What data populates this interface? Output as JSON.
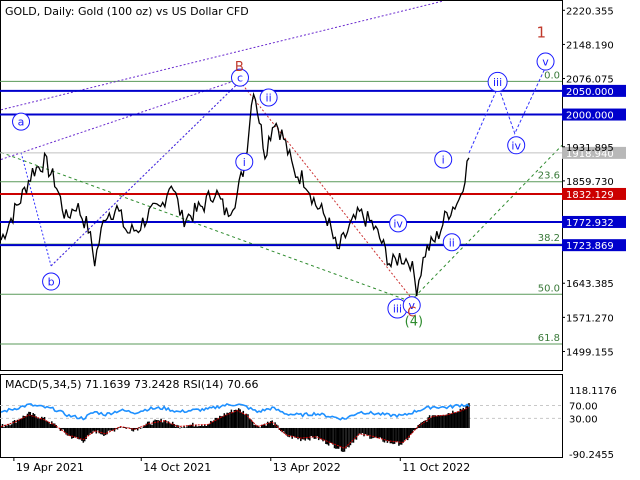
{
  "chart_data": {
    "type": "line",
    "title": "GOLD, Daily:  Gold (100 oz) vs US Dollar CFD",
    "x_ticks": [
      "19 Apr 2021",
      "14 Oct 2021",
      "13 Apr 2022",
      "11 Oct 2022"
    ],
    "x_range": [
      "2021-04-01",
      "2023-05-25"
    ],
    "price_axis": {
      "tick_labels": [
        "2220.355",
        "2148.190",
        "2076.075",
        "1931.895",
        "1859.730",
        "1643.385",
        "1571.270",
        "1499.155"
      ],
      "ylim": [
        1460,
        2240
      ]
    },
    "levels": [
      {
        "label": "2050.000",
        "value": 2050.0,
        "color": "#0000cc"
      },
      {
        "label": "2000.000",
        "value": 2000.0,
        "color": "#0000cc"
      },
      {
        "label": "1832.129",
        "value": 1832.129,
        "color": "#cc0000"
      },
      {
        "label": "1772.932",
        "value": 1772.932,
        "color": "#0000cc"
      },
      {
        "label": "1723.869",
        "value": 1723.869,
        "color": "#0000cc"
      }
    ],
    "current_price": {
      "label": "1918.940",
      "value": 1918.94
    },
    "fibonacci": [
      {
        "label": "0.0",
        "value": 2070
      },
      {
        "label": "23.6",
        "value": 1858
      },
      {
        "label": "38.2",
        "value": 1726
      },
      {
        "label": "50.0",
        "value": 1620
      },
      {
        "label": "61.8",
        "value": 1515
      }
    ],
    "price_series": {
      "x": [
        "2021-04-01",
        "2021-04-15",
        "2021-05-01",
        "2021-05-15",
        "2021-06-01",
        "2021-06-15",
        "2021-07-01",
        "2021-07-15",
        "2021-08-01",
        "2021-08-10",
        "2021-08-25",
        "2021-09-10",
        "2021-09-25",
        "2021-10-10",
        "2021-10-25",
        "2021-11-10",
        "2021-11-25",
        "2021-12-10",
        "2021-12-25",
        "2022-01-10",
        "2022-01-25",
        "2022-02-10",
        "2022-02-25",
        "2022-03-08",
        "2022-03-20",
        "2022-04-05",
        "2022-04-18",
        "2022-05-01",
        "2022-05-15",
        "2022-06-01",
        "2022-06-15",
        "2022-07-01",
        "2022-07-15",
        "2022-08-01",
        "2022-08-15",
        "2022-09-01",
        "2022-09-15",
        "2022-09-28",
        "2022-10-10",
        "2022-10-25",
        "2022-11-03",
        "2022-11-15",
        "2022-12-01",
        "2022-12-15",
        "2023-01-01",
        "2023-01-15"
      ],
      "y": [
        1735,
        1780,
        1830,
        1880,
        1900,
        1860,
        1780,
        1810,
        1760,
        1690,
        1790,
        1800,
        1750,
        1760,
        1790,
        1800,
        1860,
        1780,
        1790,
        1810,
        1840,
        1790,
        1830,
        1900,
        2060,
        1920,
        1990,
        1950,
        1880,
        1860,
        1810,
        1780,
        1710,
        1760,
        1790,
        1770,
        1730,
        1680,
        1700,
        1690,
        1635,
        1710,
        1740,
        1790,
        1820,
        1910
      ]
    },
    "projection": {
      "x": [
        "2023-01-15",
        "2023-02-25",
        "2023-03-20",
        "2023-05-05"
      ],
      "y": [
        1918.94,
        2060,
        1960,
        2110
      ]
    },
    "wave_labels": [
      {
        "text": "a",
        "x": "2021-04-29",
        "y": 1985,
        "color": "#1a1aff",
        "circled": true
      },
      {
        "text": "b",
        "x": "2021-06-10",
        "y": 1647,
        "color": "#1a1aff",
        "circled": true
      },
      {
        "text": "c",
        "x": "2022-03-01",
        "y": 2078,
        "color": "#1a1aff",
        "circled": true
      },
      {
        "text": "B",
        "x": "2022-02-28",
        "y": 2100,
        "color": "#c0392b",
        "circled": false
      },
      {
        "text": "i",
        "x": "2022-03-07",
        "y": 1900,
        "color": "#1a1aff",
        "circled": true
      },
      {
        "text": "ii",
        "x": "2022-04-10",
        "y": 2036,
        "color": "#1a1aff",
        "circled": true
      },
      {
        "text": "iii",
        "x": "2022-10-07",
        "y": 1590,
        "color": "#1a1aff",
        "circled": true
      },
      {
        "text": "iv",
        "x": "2022-10-08",
        "y": 1770,
        "color": "#1a1aff",
        "circled": true
      },
      {
        "text": "v",
        "x": "2022-10-27",
        "y": 1597,
        "color": "#1a1aff",
        "circled": true
      },
      {
        "text": "C",
        "x": "2022-10-27",
        "y": 1582,
        "color": "#c0392b",
        "circled": false
      },
      {
        "text": "(4)",
        "x": "2022-10-30",
        "y": 1562,
        "color": "#2e8b2e",
        "circled": false
      },
      {
        "text": "i",
        "x": "2022-12-10",
        "y": 1905,
        "color": "#1a1aff",
        "circled": true
      },
      {
        "text": "ii",
        "x": "2022-12-22",
        "y": 1730,
        "color": "#1a1aff",
        "circled": true
      },
      {
        "text": "iii",
        "x": "2023-02-24",
        "y": 2069,
        "color": "#1a1aff",
        "circled": true
      },
      {
        "text": "iv",
        "x": "2023-03-22",
        "y": 1935,
        "color": "#1a1aff",
        "circled": true
      },
      {
        "text": "v",
        "x": "2023-05-02",
        "y": 2112,
        "color": "#1a1aff",
        "circled": true
      },
      {
        "text": "1",
        "x": "2023-04-26",
        "y": 2171,
        "color": "#c0392b",
        "circled": false
      }
    ],
    "indicator": {
      "label": "MACD(5,34,5) 71.1639 73.2428 RSI(14) 70.66",
      "tick_labels": [
        "118.1176",
        "70.00",
        "30.00",
        "-90.2455"
      ],
      "ylim": [
        -90.2455,
        118.1176
      ],
      "rsi": {
        "x": [
          "2021-04-01",
          "2021-04-20",
          "2021-05-10",
          "2021-05-30",
          "2021-06-15",
          "2021-07-05",
          "2021-07-25",
          "2021-08-10",
          "2021-08-25",
          "2021-09-15",
          "2021-10-05",
          "2021-10-25",
          "2021-11-15",
          "2021-12-05",
          "2021-12-25",
          "2022-01-15",
          "2022-02-05",
          "2022-02-25",
          "2022-03-10",
          "2022-03-25",
          "2022-04-15",
          "2022-05-05",
          "2022-05-25",
          "2022-06-15",
          "2022-07-05",
          "2022-07-25",
          "2022-08-15",
          "2022-09-05",
          "2022-09-25",
          "2022-10-15",
          "2022-11-05",
          "2022-11-25",
          "2022-12-15",
          "2023-01-05",
          "2023-01-15"
        ],
        "y": [
          50,
          60,
          72,
          65,
          58,
          38,
          30,
          50,
          42,
          55,
          48,
          60,
          62,
          50,
          55,
          58,
          70,
          74,
          66,
          50,
          62,
          44,
          40,
          45,
          36,
          28,
          50,
          45,
          40,
          38,
          55,
          66,
          64,
          72,
          70.66
        ]
      },
      "macd": {
        "x": [
          "2021-04-01",
          "2021-04-20",
          "2021-05-10",
          "2021-05-30",
          "2021-06-15",
          "2021-07-05",
          "2021-07-25",
          "2021-08-10",
          "2021-08-25",
          "2021-09-15",
          "2021-10-05",
          "2021-10-25",
          "2021-11-15",
          "2021-12-05",
          "2021-12-25",
          "2022-01-15",
          "2022-02-05",
          "2022-02-25",
          "2022-03-10",
          "2022-03-25",
          "2022-04-15",
          "2022-05-05",
          "2022-05-25",
          "2022-06-15",
          "2022-07-05",
          "2022-07-25",
          "2022-08-15",
          "2022-09-05",
          "2022-09-25",
          "2022-10-15",
          "2022-11-05",
          "2022-11-25",
          "2022-12-15",
          "2023-01-05",
          "2023-01-15"
        ],
        "y": [
          5,
          20,
          45,
          30,
          10,
          -25,
          -40,
          -10,
          -20,
          5,
          -5,
          15,
          25,
          5,
          10,
          12,
          40,
          60,
          45,
          5,
          20,
          -25,
          -35,
          -30,
          -50,
          -70,
          -20,
          -30,
          -45,
          -50,
          5,
          40,
          45,
          60,
          71.1639
        ]
      }
    }
  }
}
